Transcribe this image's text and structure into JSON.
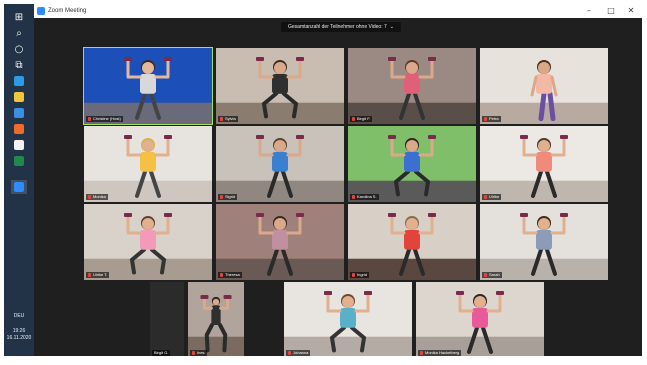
{
  "window": {
    "title": "Zoom Meeting",
    "minimize": "–",
    "maximize": "□",
    "close": "✕"
  },
  "banner": {
    "text": "Gesamtanzahl der Teilnehmer ohne Video: 7",
    "chevron": "⌄"
  },
  "taskbar": {
    "icons": [
      {
        "name": "windows-start-icon",
        "glyph": "⊞",
        "color": "#ffffff"
      },
      {
        "name": "search-icon",
        "glyph": "⌕",
        "color": "#ffffff"
      },
      {
        "name": "cortana-icon",
        "glyph": "○",
        "color": "#ffffff"
      },
      {
        "name": "task-view-icon",
        "glyph": "⧉",
        "color": "#ffffff"
      },
      {
        "name": "edge-icon",
        "glyph": "",
        "color": "#2b9be6"
      },
      {
        "name": "file-explorer-icon",
        "glyph": "",
        "color": "#f0c53b"
      },
      {
        "name": "mail-icon",
        "glyph": "",
        "color": "#3a8fe0"
      },
      {
        "name": "firefox-icon",
        "glyph": "",
        "color": "#f06a2a"
      },
      {
        "name": "notes-icon",
        "glyph": "",
        "color": "#f2f2f2"
      },
      {
        "name": "excel-icon",
        "glyph": "",
        "color": "#1f8a4c"
      },
      {
        "name": "zoom-taskbar-icon",
        "glyph": "",
        "color": "#2d8cff"
      }
    ],
    "lang": "DEU",
    "time": "19:26",
    "date": "16.11.2020"
  },
  "participants": [
    {
      "name": "Christine (Host)",
      "active": true,
      "bg": "#1d4fb8",
      "floor": "#6a6a7a",
      "shirt": "#d8d8d8",
      "pants": "#444",
      "skin": "#e3b89c",
      "hair": "#3b2a20",
      "pose": "arms-up"
    },
    {
      "name": "Sylvia",
      "active": false,
      "bg": "#c9bdb2",
      "floor": "#8a7d70",
      "shirt": "#2f2f2f",
      "pants": "#2a2a2a",
      "skin": "#d9a98a",
      "hair": "#3a2c22",
      "pose": "squat"
    },
    {
      "name": "Birgit F.",
      "active": false,
      "bg": "#9a8a83",
      "floor": "#5a4e48",
      "shirt": "#e0607a",
      "pants": "#333",
      "skin": "#dba88a",
      "hair": "#5a3a2a",
      "pose": "arms-up"
    },
    {
      "name": "Petra",
      "active": false,
      "bg": "#e8e2dd",
      "floor": "#b8aaa0",
      "shirt": "#f3b9a6",
      "pants": "#6b4fa1",
      "skin": "#d9a98a",
      "hair": "#4a3020",
      "pose": "bend"
    },
    {
      "name": "Monika",
      "active": false,
      "bg": "#e7e3df",
      "floor": "#cfc7bf",
      "shirt": "#f4c144",
      "pants": "#444",
      "skin": "#e0b08f",
      "hair": "#d9b04a",
      "pose": "arms-up"
    },
    {
      "name": "Sigrid",
      "active": false,
      "bg": "#c8c2bb",
      "floor": "#8f8780",
      "shirt": "#3b7fd0",
      "pants": "#2a2a2a",
      "skin": "#d9a98a",
      "hair": "#5a4030",
      "pose": "arms-up"
    },
    {
      "name": "Karolina S.",
      "active": false,
      "bg": "#7fbf6a",
      "floor": "#5a5a5a",
      "shirt": "#3b6fd0",
      "pants": "#2a2a2a",
      "skin": "#d9a98a",
      "hair": "#2e2420",
      "pose": "squat"
    },
    {
      "name": "Ulrike",
      "active": false,
      "bg": "#ece8e4",
      "floor": "#bfb6ad",
      "shirt": "#f08a7a",
      "pants": "#2a2a2a",
      "skin": "#e0b08f",
      "hair": "#4a3a30",
      "pose": "arms-up"
    },
    {
      "name": "Ulrike T.",
      "active": false,
      "bg": "#d9d2ca",
      "floor": "#a89c90",
      "shirt": "#f29ab8",
      "pants": "#333",
      "skin": "#e0b08f",
      "hair": "#5a4030",
      "pose": "squat"
    },
    {
      "name": "Theresa",
      "active": false,
      "bg": "#a0807a",
      "floor": "#6a5a55",
      "shirt": "#c090a0",
      "pants": "#2a2a2a",
      "skin": "#d9a98a",
      "hair": "#3a2a20",
      "pose": "arms-up"
    },
    {
      "name": "Ingrid",
      "active": false,
      "bg": "#d8cfc7",
      "floor": "#5a4840",
      "shirt": "#e0443c",
      "pants": "#2a2a2a",
      "skin": "#e0b08f",
      "hair": "#8a6a4a",
      "pose": "arms-up"
    },
    {
      "name": "Sarah",
      "active": false,
      "bg": "#e4e0dc",
      "floor": "#b9b2aa",
      "shirt": "#8a9cb8",
      "pants": "#2a2a2a",
      "skin": "#e0b08f",
      "hair": "#3a2a20",
      "pose": "arms-up"
    },
    {
      "name": "Ines",
      "active": false,
      "bg": "#b0a49c",
      "floor": "#7a6a60",
      "shirt": "#2f2f2f",
      "pants": "#2a2a2a",
      "skin": "#d9a98a",
      "hair": "#2e2420",
      "pose": "squat"
    },
    {
      "name": "Johanna",
      "active": false,
      "bg": "#e8e4e0",
      "floor": "#b4aca4",
      "shirt": "#5ab0c8",
      "pants": "#333",
      "skin": "#e0b08f",
      "hair": "#6a4a30",
      "pose": "squat"
    },
    {
      "name": "Monika Hackelberg",
      "active": false,
      "bg": "#ddd6cf",
      "floor": "#a8a098",
      "shirt": "#e85a9a",
      "pants": "#2a2a2a",
      "skin": "#e0b08f",
      "hair": "#2e2420",
      "pose": "arms-up"
    }
  ],
  "blank_tiles": [
    {
      "name": "Birgit G."
    }
  ]
}
